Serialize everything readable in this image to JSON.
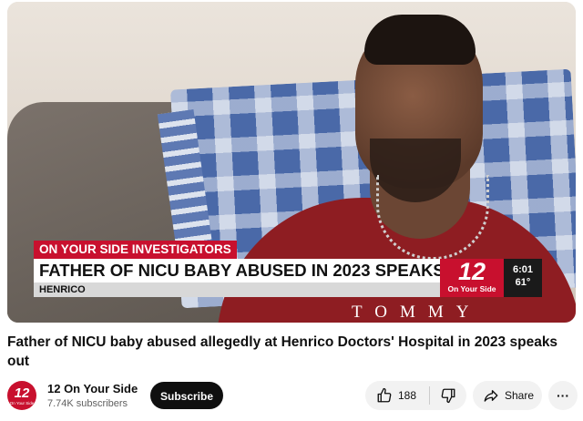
{
  "video": {
    "overlay": {
      "kicker": "ON YOUR SIDE INVESTIGATORS",
      "headline": "FATHER OF NICU BABY ABUSED IN 2023 SPEAKS OUT",
      "location": "HENRICO",
      "station_logo_number": "12",
      "station_logo_sub": "On Your Side",
      "time": "6:01",
      "temperature": "61°"
    },
    "shirt_text": "TOMMY"
  },
  "title": "Father of NICU baby abused allegedly at Henrico Doctors' Hospital in 2023 speaks out",
  "channel": {
    "avatar_number": "12",
    "avatar_sub": "On Your Side",
    "name": "12 On Your Side",
    "subscribers": "7.74K subscribers"
  },
  "actions": {
    "subscribe_label": "Subscribe",
    "like_count": "188",
    "share_label": "Share",
    "more_label": "···"
  },
  "icons": {
    "like": "thumbs-up-icon",
    "dislike": "thumbs-down-icon",
    "share": "share-arrow-icon",
    "more": "more-horizontal-icon"
  },
  "colors": {
    "brand_red": "#c8102e",
    "subscribe_bg": "#0f0f0f",
    "pill_bg": "#f2f2f2"
  }
}
